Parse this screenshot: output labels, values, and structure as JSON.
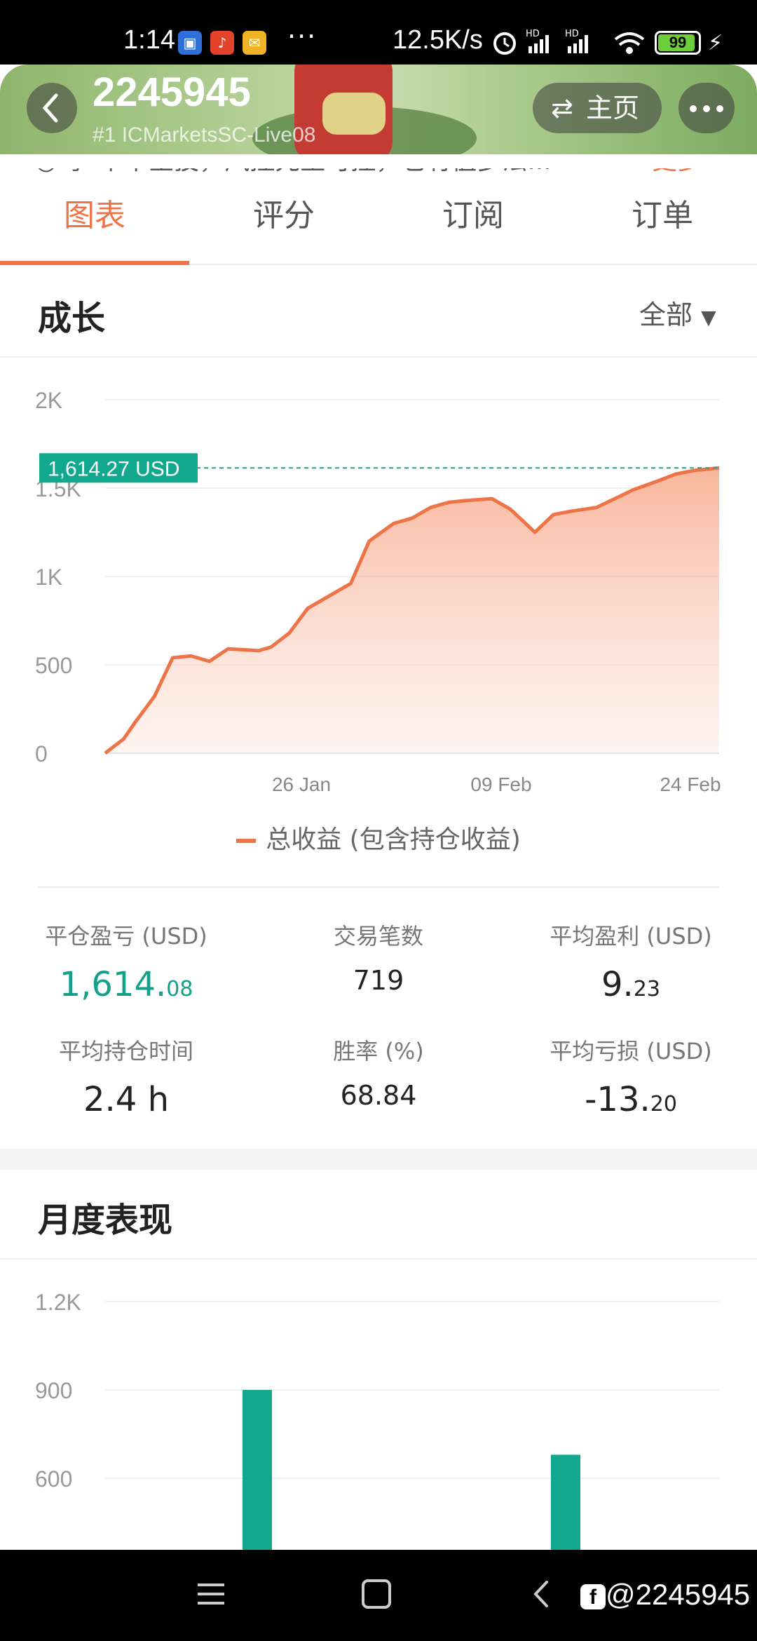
{
  "status_bar": {
    "time": "1:14",
    "app_icons": [
      "calendar-app-icon",
      "listen-app-icon",
      "mail-app-icon"
    ],
    "dots": "···",
    "speed": "12.5K/s",
    "signal1": "HD",
    "signal2": "HD",
    "battery": "99"
  },
  "header": {
    "title": "2245945",
    "subtitle": "#1  ICMarketsSC-Live08",
    "home_label": "主页"
  },
  "description": {
    "text": "◎ 季   单币金投，风控先至可控，它有值多法...",
    "more": "更多"
  },
  "tabs": [
    {
      "label": "图表",
      "active": true
    },
    {
      "label": "评分",
      "active": false
    },
    {
      "label": "订阅",
      "active": false
    },
    {
      "label": "订单",
      "active": false
    }
  ],
  "growth": {
    "title": "成长",
    "filter": "全部"
  },
  "chart_data": [
    {
      "type": "area",
      "title": "",
      "ylim": [
        0,
        2000
      ],
      "y_ticks": [
        "0",
        "500",
        "1K",
        "1.5K",
        "2K"
      ],
      "x_ticks": [
        "26 Jan",
        "09 Feb",
        "24 Feb"
      ],
      "current_label": "1,614.27 USD",
      "legend": "总收益 (包含持仓收益)",
      "color": "#ec7447",
      "x": [
        0,
        3,
        5,
        8,
        11,
        14,
        17,
        20,
        25,
        27,
        30,
        33,
        37,
        40,
        43,
        47,
        50,
        53,
        56,
        59,
        63,
        66,
        70,
        73,
        76,
        80,
        83,
        86,
        90,
        93,
        96,
        100
      ],
      "y": [
        0,
        80,
        180,
        320,
        540,
        550,
        520,
        590,
        580,
        600,
        680,
        820,
        900,
        960,
        1200,
        1300,
        1330,
        1390,
        1420,
        1430,
        1440,
        1380,
        1250,
        1350,
        1370,
        1390,
        1440,
        1490,
        1540,
        1580,
        1600,
        1614
      ]
    },
    {
      "type": "bar",
      "title": "月度表现",
      "ylim": [
        0,
        1200
      ],
      "y_ticks": [
        "600",
        "900",
        "1.2K"
      ],
      "values": [
        900,
        680
      ],
      "color": "#12a88f"
    }
  ],
  "stats": {
    "closed_pnl_label": "平仓盈亏 (USD)",
    "closed_pnl_main": "1,614.",
    "closed_pnl_dec": "08",
    "trades_label": "交易笔数",
    "trades_value": "719",
    "avg_profit_label": "平均盈利 (USD)",
    "avg_profit_main": "9.",
    "avg_profit_dec": "23",
    "avg_hold_label": "平均持仓时间",
    "avg_hold_value": "2.4 h",
    "win_rate_label": "胜率 (%)",
    "win_rate_value": "68.84",
    "avg_loss_label": "平均亏损 (USD)",
    "avg_loss_main": "-13.",
    "avg_loss_dec": "20"
  },
  "monthly": {
    "title": "月度表现"
  },
  "nav": {
    "watermark": "@2245945"
  }
}
